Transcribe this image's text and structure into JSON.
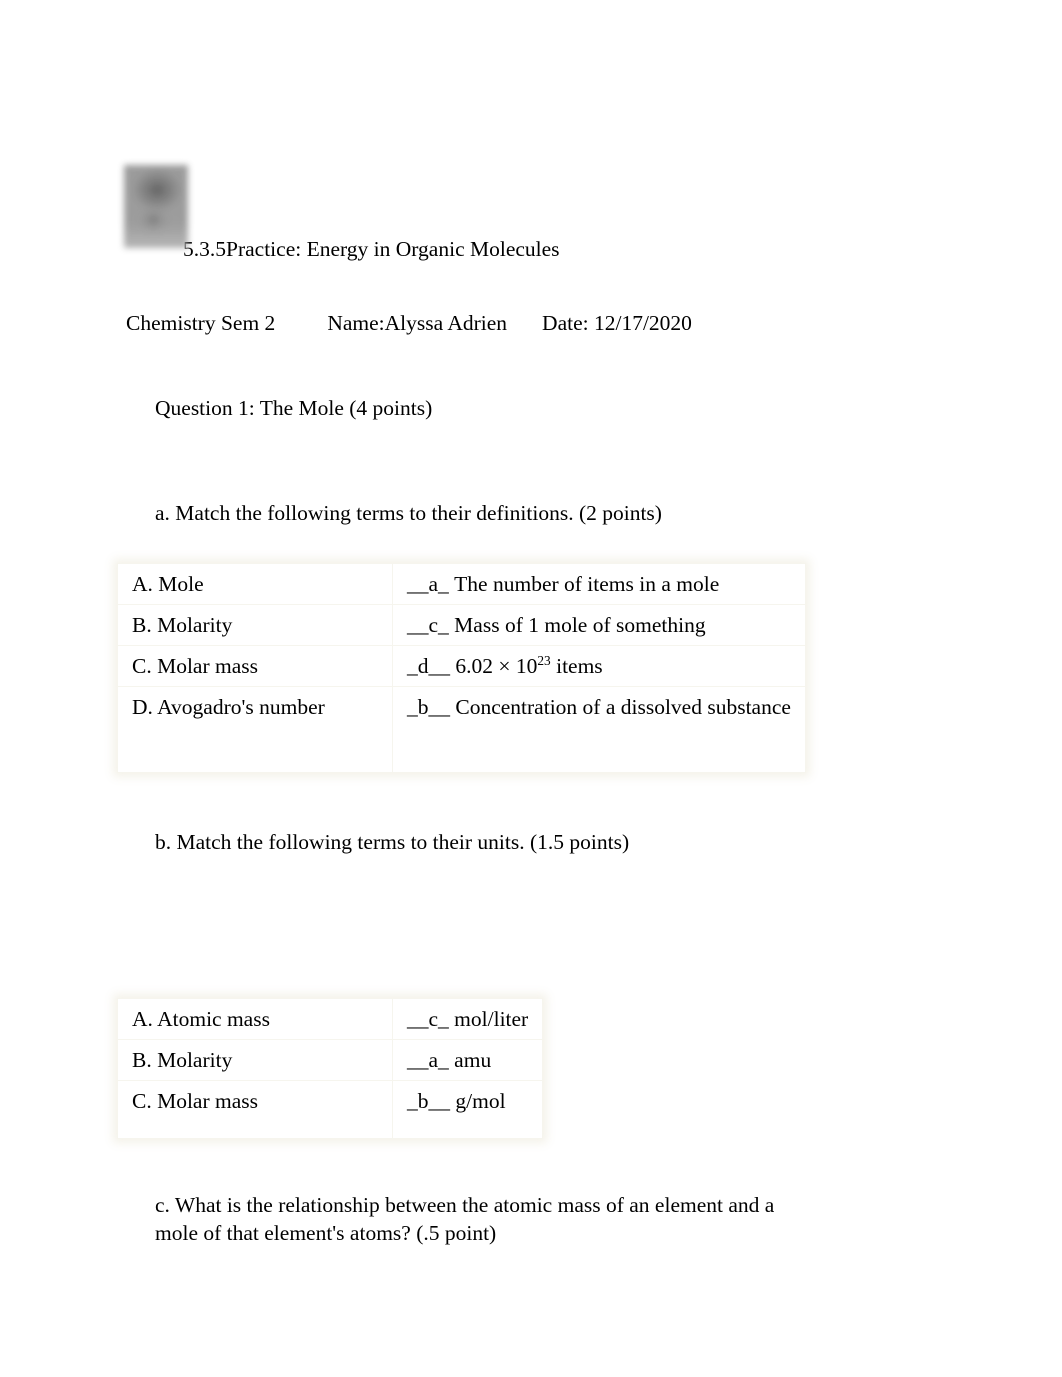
{
  "document": {
    "logo_icon": "school-logo-image",
    "title": "5.3.5Practice: Energy in Organic Molecules",
    "meta": {
      "course": "Chemistry Sem 2",
      "name": "Name:Alyssa Adrien",
      "date": "Date: 12/17/2020"
    },
    "question_heading": "Question 1: The Mole (4 points)",
    "part_a_prompt": "a. Match the following terms to their definitions. (2 points)",
    "part_b_prompt": "b. Match the following terms to their units. (1.5 points)",
    "part_c_prompt": "c. What is the relationship between the atomic mass of an element and a mole of that element's atoms? (.5 point)"
  },
  "table_a": {
    "rows": [
      {
        "term": "A. Mole",
        "answer": "__a_",
        "definition": "The number of items in a mole"
      },
      {
        "term": "B. Molarity",
        "answer": "__c_",
        "definition": "Mass of 1 mole of something"
      },
      {
        "term": "C. Molar mass",
        "answer": "_d__",
        "definition_pre": "6.02 × 10",
        "definition_sup": "23",
        "definition_post": " items"
      },
      {
        "term": "D. Avogadro's number",
        "answer": "_b__",
        "definition": "Concentration of a dissolved substance"
      }
    ]
  },
  "table_b": {
    "rows": [
      {
        "term": "A. Atomic mass",
        "answer": "__c_",
        "unit": "mol/liter"
      },
      {
        "term": "B. Molarity",
        "answer": "__a_",
        "unit": "amu"
      },
      {
        "term": "C. Molar mass",
        "answer": "_b__",
        "unit": "g/mol"
      }
    ]
  },
  "colors": {
    "page_background": "#ffffff",
    "text": "#000000",
    "table_border": "#f6f5ee",
    "table_glow": "#f3f1e8"
  }
}
